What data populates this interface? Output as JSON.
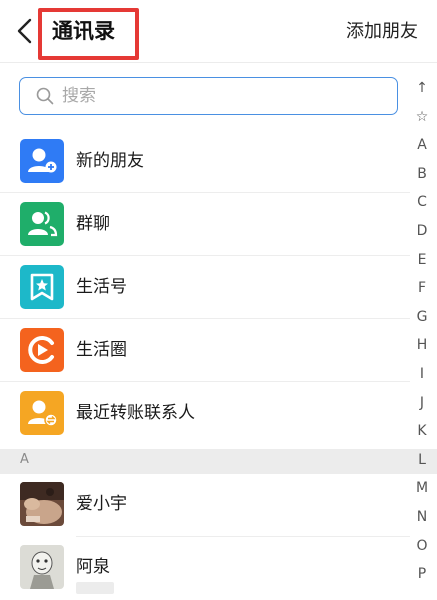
{
  "header": {
    "title": "通讯录",
    "add_friend_label": "添加朋友"
  },
  "search": {
    "placeholder": "搜索",
    "value": ""
  },
  "menu": [
    {
      "label": "新的朋友",
      "icon": "new-friend-icon",
      "color": "#2f7bf5"
    },
    {
      "label": "群聊",
      "icon": "group-chat-icon",
      "color": "#1fae6a"
    },
    {
      "label": "生活号",
      "icon": "life-account-icon",
      "color": "#1db8c9"
    },
    {
      "label": "生活圈",
      "icon": "life-circle-icon",
      "color": "#f4631e"
    },
    {
      "label": "最近转账联系人",
      "icon": "recent-transfer-icon",
      "color": "#f5a623"
    }
  ],
  "section": {
    "letter": "A"
  },
  "contacts": [
    {
      "name": "爱小宇",
      "avatar": "photo-avatar"
    },
    {
      "name": "阿泉",
      "avatar": "sketch-avatar"
    }
  ],
  "index": {
    "items": [
      "↑",
      "☆",
      "A",
      "B",
      "C",
      "D",
      "E",
      "F",
      "G",
      "H",
      "I",
      "J",
      "K",
      "L",
      "M",
      "N",
      "O",
      "P"
    ]
  },
  "colors": {
    "accent": "#4a90e2",
    "highlight_border": "#e53935"
  }
}
